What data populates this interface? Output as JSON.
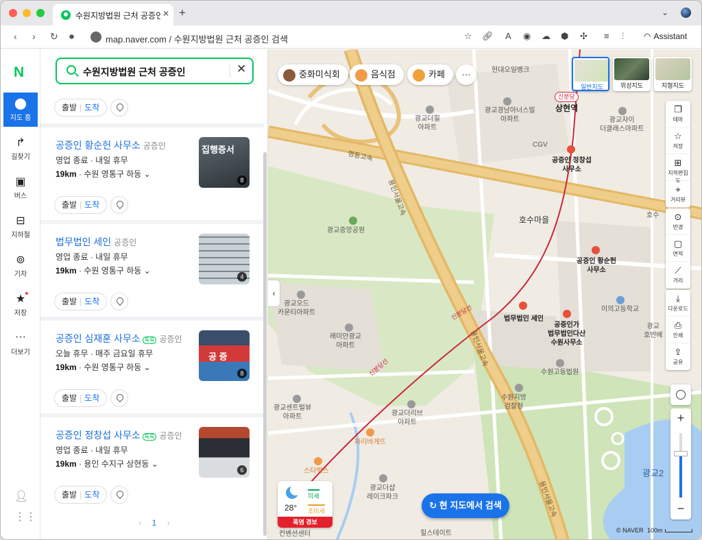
{
  "browser": {
    "tab_title": "수원지방법원 근처 공증인 검색 -",
    "url": "map.naver.com / 수원지방법원 근처 공증인 검색",
    "assistant_label": "Assistant"
  },
  "rail": {
    "logo": "N",
    "items": [
      {
        "label": "지도 홈",
        "icon": "pin-icon"
      },
      {
        "label": "길찾기",
        "icon": "route-arrow-icon"
      },
      {
        "label": "버스",
        "icon": "bus-icon"
      },
      {
        "label": "지하철",
        "icon": "subway-icon"
      },
      {
        "label": "기차",
        "icon": "train-icon"
      },
      {
        "label": "저장",
        "icon": "star-icon"
      },
      {
        "label": "더보기",
        "icon": "more-icon"
      }
    ]
  },
  "search": {
    "query": "수원지방법원 근처 공증인"
  },
  "route": {
    "depart": "출발",
    "arrive": "도착"
  },
  "results": [
    {
      "name": "공증인 황순헌 사무소",
      "category": "공증인",
      "talktalk": "",
      "hours": "영업 종료 · 내일 휴무",
      "distance": "19km",
      "address": "수원 영통구 하동",
      "photo_count": "8",
      "photo_text": "집행증서"
    },
    {
      "name": "법무법인 세인",
      "category": "공증인",
      "talktalk": "",
      "hours": "영업 종료 · 내일 휴무",
      "distance": "19km",
      "address": "수원 영통구 하동",
      "photo_count": "4",
      "photo_text": ""
    },
    {
      "name": "공증인 심재훈 사무소",
      "category": "공증인",
      "talktalk": "톡톡",
      "hours": "오늘 휴무 · 매주 금요일 휴무",
      "distance": "19km",
      "address": "수원 영통구 하동",
      "photo_count": "8",
      "photo_text": "공 증"
    },
    {
      "name": "공증인 정창섭 사무소",
      "category": "공증인",
      "talktalk": "톡톡",
      "hours": "영업 종료 · 내일 휴무",
      "distance": "19km",
      "address": "용인 수지구 상현동",
      "photo_count": "6",
      "photo_text": ""
    }
  ],
  "pager": {
    "current": "1"
  },
  "map": {
    "chips": [
      "중화미식회",
      "음식점",
      "카페"
    ],
    "map_types": [
      "일반지도",
      "위성지도",
      "지형지도"
    ],
    "tools": [
      "테마",
      "저장",
      "지적편집도",
      "거리뷰",
      "반경",
      "면적",
      "거리",
      "다운로드",
      "인쇄",
      "공유"
    ],
    "labels": {
      "bank": "현대오일뱅크",
      "station_badge": "신분당",
      "station": "상현역",
      "apt1": "광교더힐\n아파트",
      "apt2": "광교경남아너스빌\n아파트",
      "apt3": "광교자이\n더클래스아파트",
      "cgv": "CGV",
      "office_top": "공증인 정창섭\n사무소",
      "highway": "영동고속",
      "park": "광교중앙공원",
      "village": "호수마을",
      "office_mid": "공증인 황순헌\n사무소",
      "hosu": "호수",
      "seine": "법무법인 세인",
      "dasan": "공증인가\n법무법인다산\n수원사무소",
      "elem": "이의고등학교",
      "ode": "광교오드\n카운티아파트",
      "raemian": "래미안광교\n아파트",
      "court": "수원고등법원",
      "prosecutor": "수원지방\n검찰청",
      "central": "광교센트럴뷰\n아파트",
      "the_rich": "광교더리브\n아파트",
      "paris": "파리바게뜨",
      "starbucks": "스타벅스",
      "lake": "광교더샵\n레이크파크",
      "hillstate": "힐스테이트",
      "convention": "컨벤션센터",
      "gwanggyo": "광교2",
      "line": "신분당선",
      "expressway": "용인서울고속",
      "hobanville": "광교\n호반베"
    },
    "weather": {
      "temp": "28°",
      "fine_dust": "미세",
      "ultra_dust": "초미세",
      "alert": "폭염 경보"
    },
    "research_button": "현 지도에서 검색",
    "copyright": "© NAVER",
    "scale": "100m"
  }
}
